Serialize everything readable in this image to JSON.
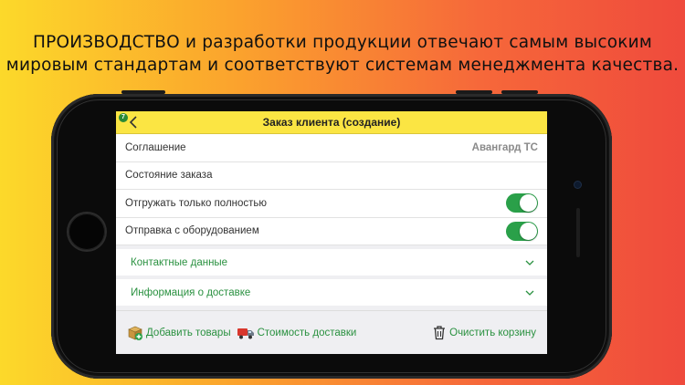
{
  "promo": {
    "line1": "ПРОИЗВОДСТВО и разработки продукции отвечают самым высоким",
    "line2": "мировым стандартам и соответствуют системам менеджмента качества."
  },
  "app": {
    "badge": "7",
    "title": "Заказ клиента (создание)",
    "fields": [
      {
        "label": "Соглашение",
        "value": "Авангард ТС"
      },
      {
        "label": "Состояние заказа",
        "value": ""
      },
      {
        "label": "Отгружать только полностью",
        "toggle": true
      },
      {
        "label": "Отправка с оборудованием",
        "toggle": true
      }
    ],
    "sections": [
      {
        "label": "Контактные данные"
      },
      {
        "label": "Информация о доставке"
      }
    ],
    "toolbar": {
      "add_goods": "Добавить товары",
      "delivery_cost": "Стоимость доставки",
      "clear_cart": "Очистить корзину"
    }
  },
  "colors": {
    "accent_green": "#2a9140",
    "toggle_on": "#2aa049",
    "navbar_yellow": "#fbe543"
  }
}
